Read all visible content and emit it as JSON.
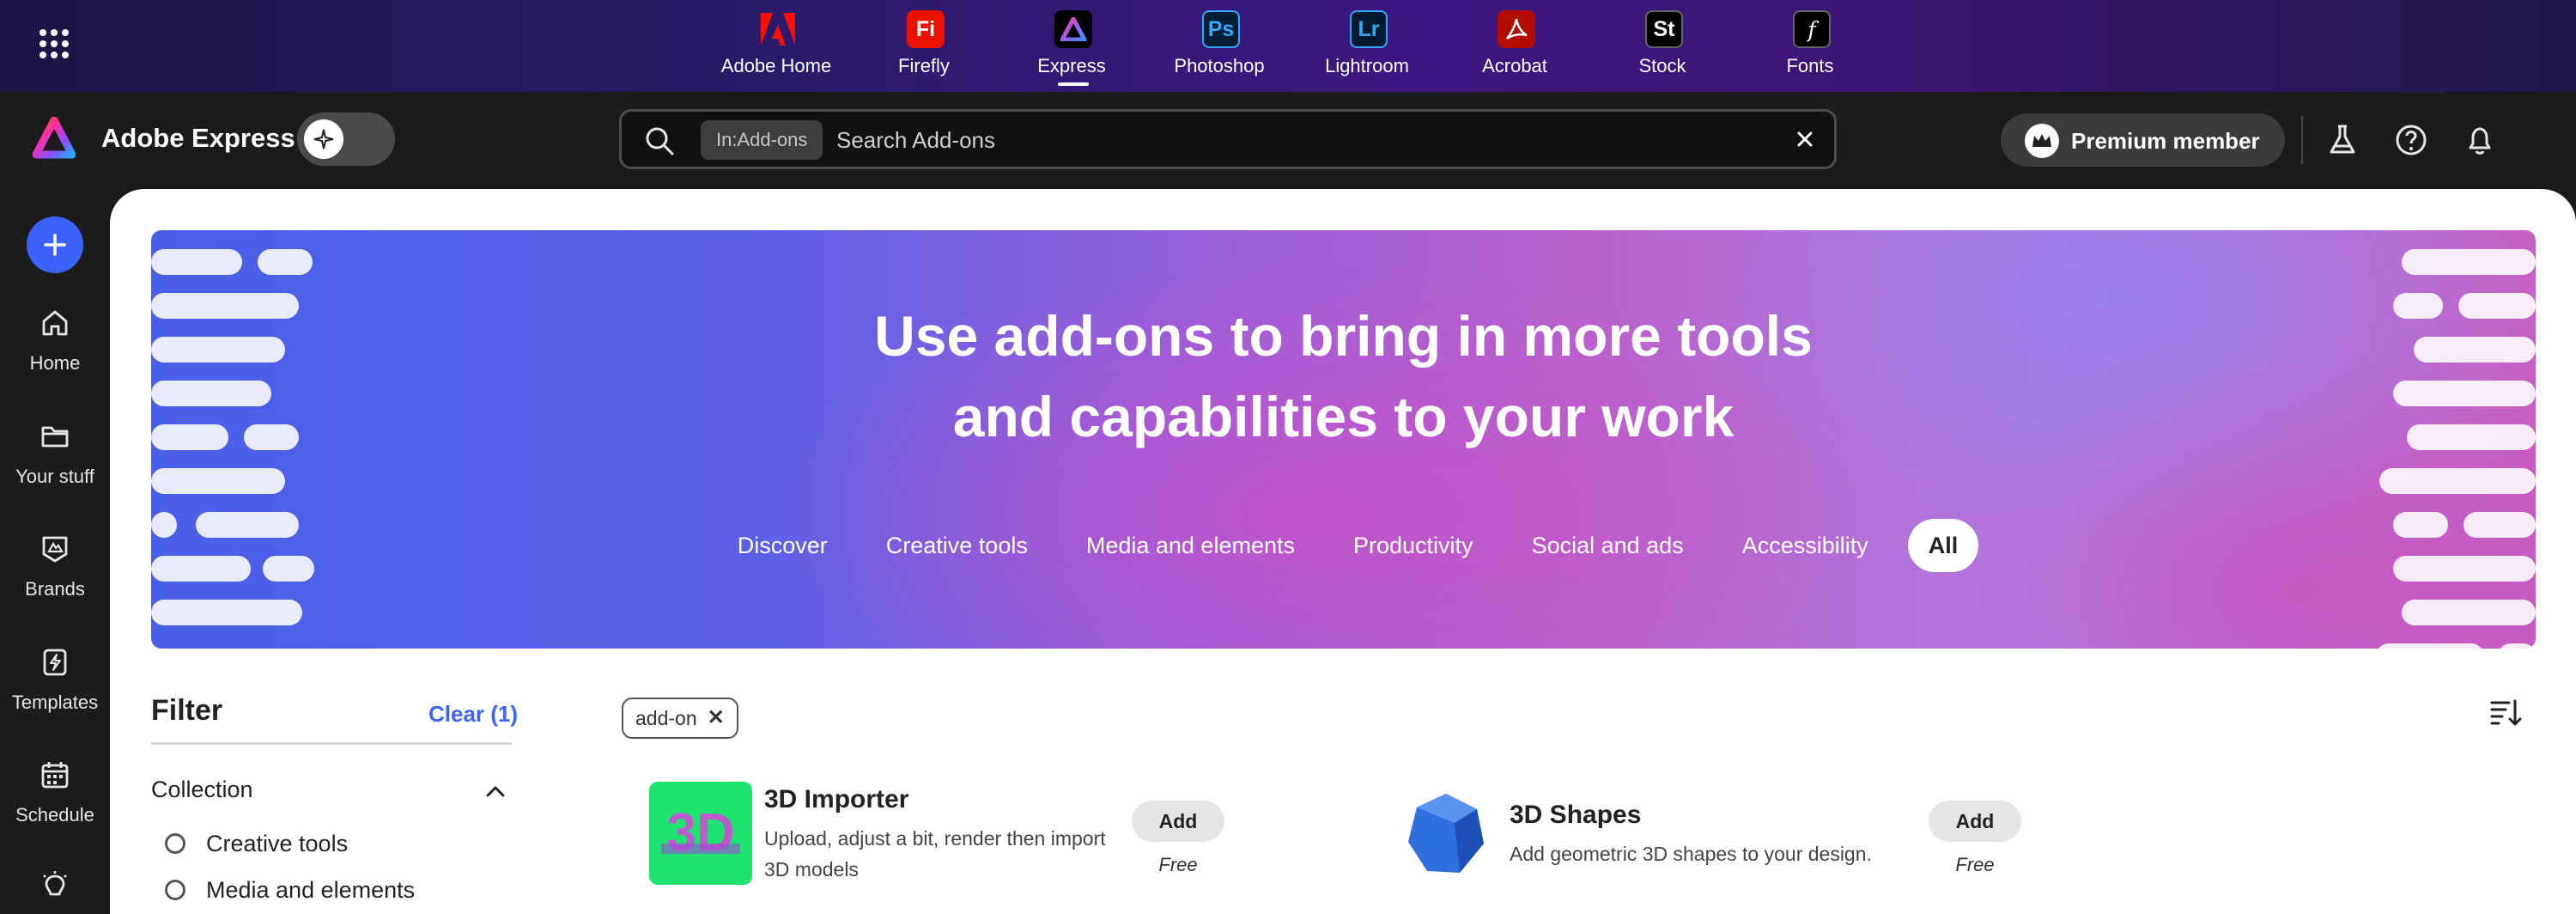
{
  "topbar": {
    "apps": [
      {
        "label": "Adobe Home",
        "icon": "adobe-logo",
        "tile_bg": "",
        "tile_text": "",
        "tile_color": "#ff0000"
      },
      {
        "label": "Firefly",
        "icon": "firefly-icon",
        "tile_bg": "#eb1000",
        "tile_text": "Fi",
        "tile_color": "#ffffff"
      },
      {
        "label": "Express",
        "icon": "express-icon",
        "tile_bg": "#000000",
        "tile_text": "",
        "tile_color": "#ffffff",
        "active": true
      },
      {
        "label": "Photoshop",
        "icon": "photoshop-icon",
        "tile_bg": "#001e36",
        "tile_text": "Ps",
        "tile_color": "#31a8ff"
      },
      {
        "label": "Lightroom",
        "icon": "lightroom-icon",
        "tile_bg": "#001a2f",
        "tile_text": "Lr",
        "tile_color": "#31a8ff"
      },
      {
        "label": "Acrobat",
        "icon": "acrobat-icon",
        "tile_bg": "#b30b00",
        "tile_text": "",
        "tile_color": "#ffffff"
      },
      {
        "label": "Stock",
        "icon": "stock-icon",
        "tile_bg": "#000000",
        "tile_text": "St",
        "tile_color": "#ffffff"
      },
      {
        "label": "Fonts",
        "icon": "fonts-icon",
        "tile_bg": "#000000",
        "tile_text": "f",
        "tile_color": "#ffffff"
      }
    ]
  },
  "header": {
    "app_name": "Adobe Express",
    "search": {
      "scope_chip": "In:Add-ons",
      "placeholder": "Search Add-ons",
      "value": ""
    },
    "premium_label": "Premium member"
  },
  "rail": {
    "items": [
      {
        "label": "Home",
        "icon": "home-icon"
      },
      {
        "label": "Your stuff",
        "icon": "folder-icon"
      },
      {
        "label": "Brands",
        "icon": "brands-icon"
      },
      {
        "label": "Templates",
        "icon": "templates-icon"
      },
      {
        "label": "Schedule",
        "icon": "calendar-icon"
      },
      {
        "label": "",
        "icon": "lightbulb-icon"
      }
    ]
  },
  "hero": {
    "headline_line1": "Use add-ons to bring in more tools",
    "headline_line2": "and capabilities to your work",
    "tabs": [
      "Discover",
      "Creative tools",
      "Media and elements",
      "Productivity",
      "Social and ads",
      "Accessibility",
      "All"
    ],
    "active_tab": "All"
  },
  "filter": {
    "title": "Filter",
    "clear_label": "Clear (1)",
    "section": "Collection",
    "options": [
      "Creative tools",
      "Media and elements"
    ]
  },
  "results": {
    "active_tag": "add-on",
    "cards": [
      {
        "name": "3D Importer",
        "description": "Upload, adjust a bit, render then import 3D models",
        "button": "Add",
        "price": "Free",
        "thumb_text": "3D"
      },
      {
        "name": "3D Shapes",
        "description": "Add geometric 3D shapes to your design.",
        "button": "Add",
        "price": "Free"
      }
    ]
  },
  "colors": {
    "accent": "#3b63fb",
    "topbar": "#2a1a6b",
    "header_bg": "#1b1b1b"
  }
}
